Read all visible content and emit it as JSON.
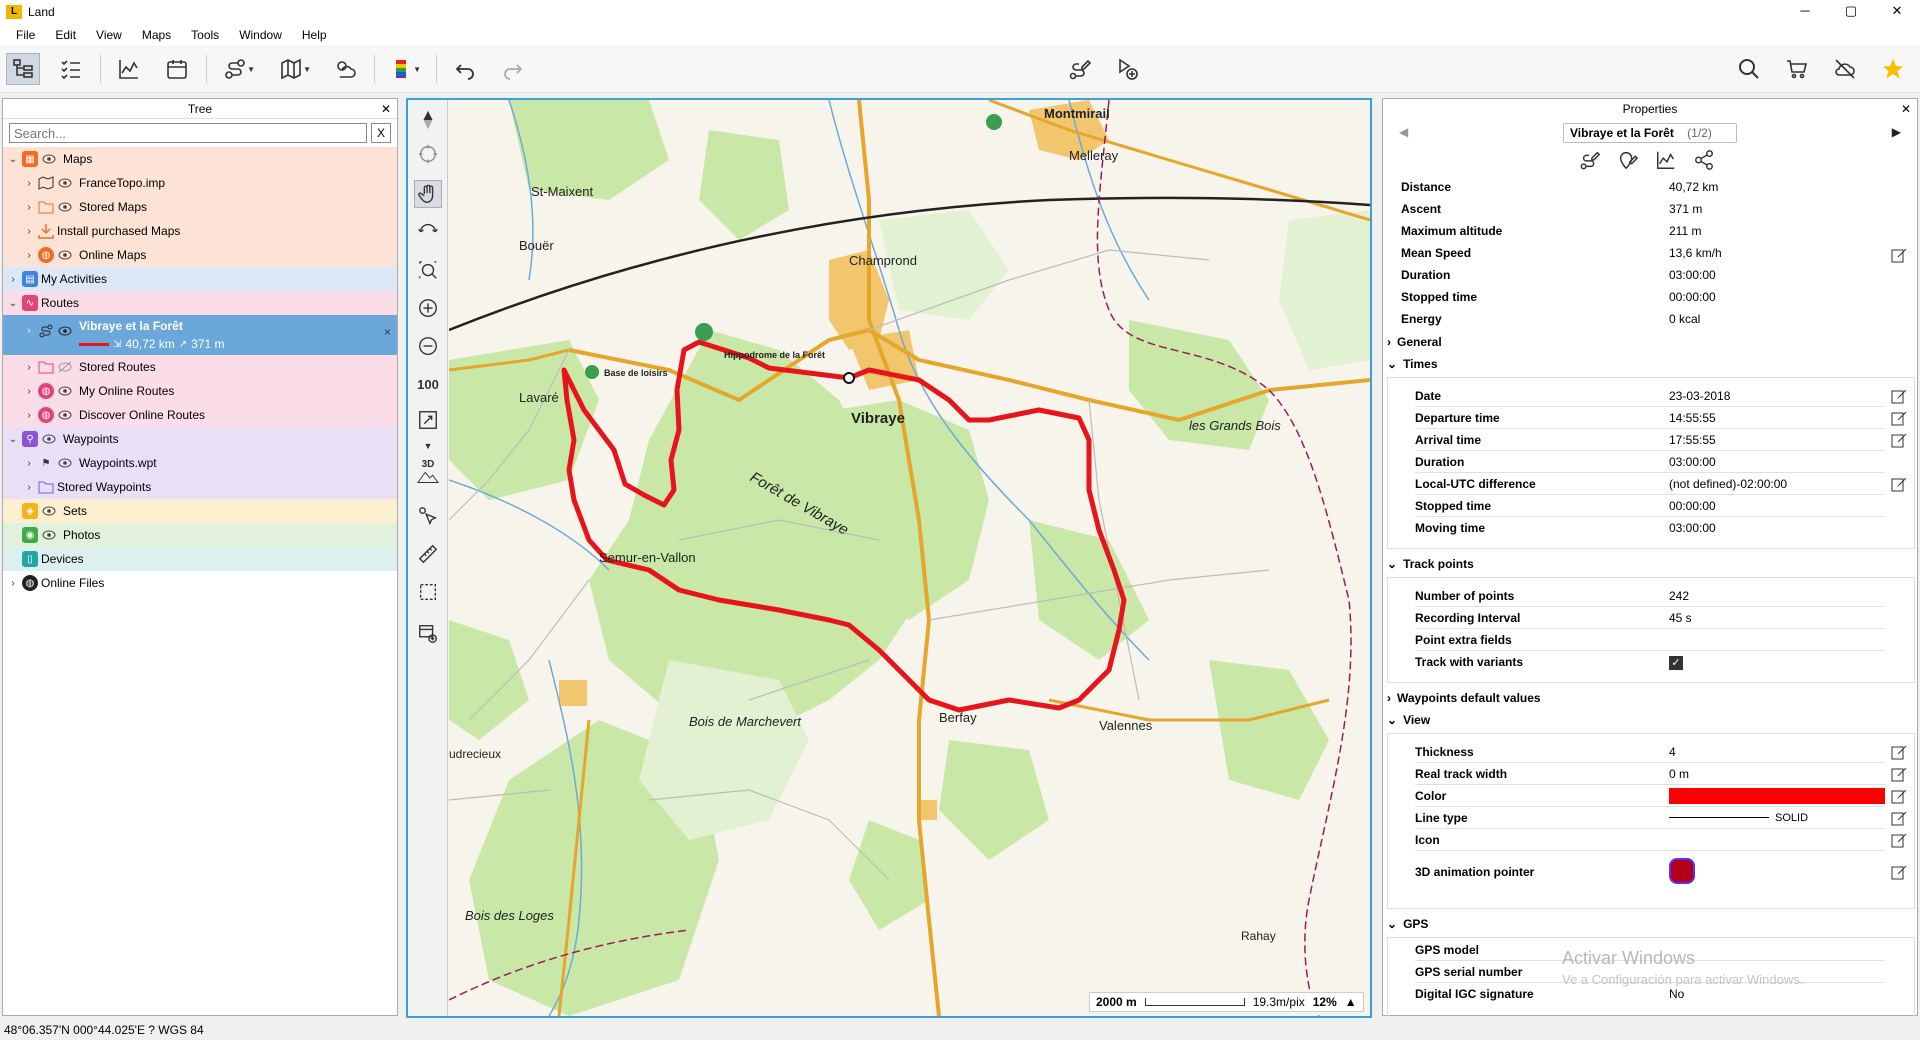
{
  "window": {
    "title": "Land",
    "btn_min": "─",
    "btn_max": "▢",
    "btn_close": "✕"
  },
  "menu": [
    "File",
    "Edit",
    "View",
    "Maps",
    "Tools",
    "Window",
    "Help"
  ],
  "tree": {
    "title": "Tree",
    "close": "✕",
    "search_placeholder": "Search...",
    "clear": "X",
    "rows": [
      {
        "label": "Maps"
      },
      {
        "label": "FranceTopo.imp"
      },
      {
        "label": "Stored Maps"
      },
      {
        "label": "Install purchased Maps"
      },
      {
        "label": "Online Maps"
      },
      {
        "label": "My Activities"
      },
      {
        "label": "Routes"
      },
      {
        "label": "Vibraye et la Forêt",
        "distance": "40,72 km",
        "ascent": "371 m"
      },
      {
        "label": "Stored Routes"
      },
      {
        "label": "My Online Routes"
      },
      {
        "label": "Discover Online Routes"
      },
      {
        "label": "Waypoints"
      },
      {
        "label": "Waypoints.wpt"
      },
      {
        "label": "Stored Waypoints"
      },
      {
        "label": "Sets"
      },
      {
        "label": "Photos"
      },
      {
        "label": "Devices"
      },
      {
        "label": "Online Files"
      }
    ]
  },
  "map": {
    "zoom_badge": "100",
    "three_d": "3D",
    "scale_distance": "2000 m",
    "resolution": "19.3m/pix",
    "zoom": "12%",
    "route_color": "#e8141b",
    "labels": {
      "vibraye": "Vibraye",
      "lavare": "Lavaré",
      "berfay": "Berfay",
      "valennes": "Valennes",
      "semur": "Semur-en-Vallon",
      "champrond": "Champrond",
      "melleray": "Melleray",
      "montmirail": "Montmirail",
      "st_maixent": "St-Maixent",
      "bouer": "Bouër",
      "foret": "Forêt de Vibraye",
      "bois_marchevert": "Bois de Marchevert",
      "bois_loges": "Bois des Loges",
      "grands_bois": "les Grands Bois",
      "rahay": "Rahay",
      "hippodrome": "Hippodrome de la Forêt",
      "base_loisirs": "Base de loisirs",
      "dreux": "udrecieux"
    }
  },
  "properties": {
    "title": "Properties",
    "close": "✕",
    "route_name": "Vibraye et la Forêt",
    "route_index": "(1/2)",
    "summary": [
      {
        "k": "Distance",
        "v": "40,72 km"
      },
      {
        "k": "Ascent",
        "v": "371 m"
      },
      {
        "k": "Maximum altitude",
        "v": "211 m"
      },
      {
        "k": "Mean Speed",
        "v": "13,6 km/h"
      },
      {
        "k": "Duration",
        "v": "03:00:00"
      },
      {
        "k": "Stopped time",
        "v": "00:00:00"
      },
      {
        "k": "Energy",
        "v": "0 kcal"
      }
    ],
    "sections": {
      "general": "General",
      "times": "Times",
      "track_points": "Track points",
      "wp_defaults": "Waypoints default values",
      "view": "View",
      "gps": "GPS"
    },
    "times": [
      {
        "k": "Date",
        "v": "23-03-2018"
      },
      {
        "k": "Departure time",
        "v": "14:55:55"
      },
      {
        "k": "Arrival time",
        "v": "17:55:55"
      },
      {
        "k": "Duration",
        "v": "03:00:00"
      },
      {
        "k": "Local-UTC difference",
        "v": " (not defined)-02:00:00"
      },
      {
        "k": "Stopped time",
        "v": "00:00:00"
      },
      {
        "k": "Moving time",
        "v": "03:00:00"
      }
    ],
    "track_points": [
      {
        "k": "Number of points",
        "v": "242"
      },
      {
        "k": "Recording Interval",
        "v": "45 s"
      },
      {
        "k": "Point extra fields",
        "v": ""
      },
      {
        "k": "Track with variants",
        "v": ""
      }
    ],
    "view": [
      {
        "k": "Thickness",
        "v": "4"
      },
      {
        "k": "Real track width",
        "v": "0 m"
      },
      {
        "k": "Color",
        "v": ""
      },
      {
        "k": "Line type",
        "v": "SOLID"
      },
      {
        "k": "Icon",
        "v": ""
      },
      {
        "k": "3D animation pointer",
        "v": ""
      }
    ],
    "gps": [
      {
        "k": "GPS model",
        "v": ""
      },
      {
        "k": "GPS serial number",
        "v": ""
      },
      {
        "k": "Digital IGC signature",
        "v": "No"
      }
    ]
  },
  "status": {
    "coords": "48°06.357'N 000°44.025'E  ?  WGS 84"
  },
  "watermark": {
    "line1": "Activar Windows",
    "line2": "Ve a Configuración para activar Windows."
  }
}
